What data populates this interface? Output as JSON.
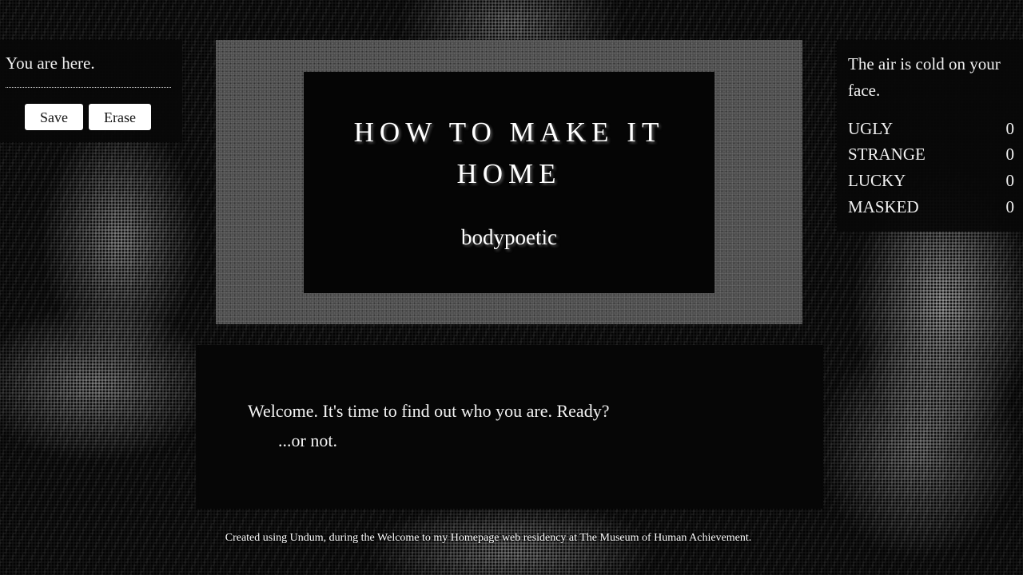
{
  "status": {
    "location": "You are here.",
    "save_label": "Save",
    "erase_label": "Erase"
  },
  "title": {
    "heading": "HOW TO MAKE IT HOME",
    "author": "bodypoetic"
  },
  "sidebar": {
    "description": "The air is cold on your face.",
    "stats": [
      {
        "name": "UGLY",
        "value": "0"
      },
      {
        "name": "STRANGE",
        "value": "0"
      },
      {
        "name": "LUCKY",
        "value": "0"
      },
      {
        "name": "MASKED",
        "value": "0"
      }
    ]
  },
  "content": {
    "line1": "Welcome. It's time to find out who you are. Ready?",
    "line2": "...or not."
  },
  "footer": {
    "text": "Created using Undum, during the Welcome to my Homepage web residency at The Museum of Human Achievement."
  }
}
